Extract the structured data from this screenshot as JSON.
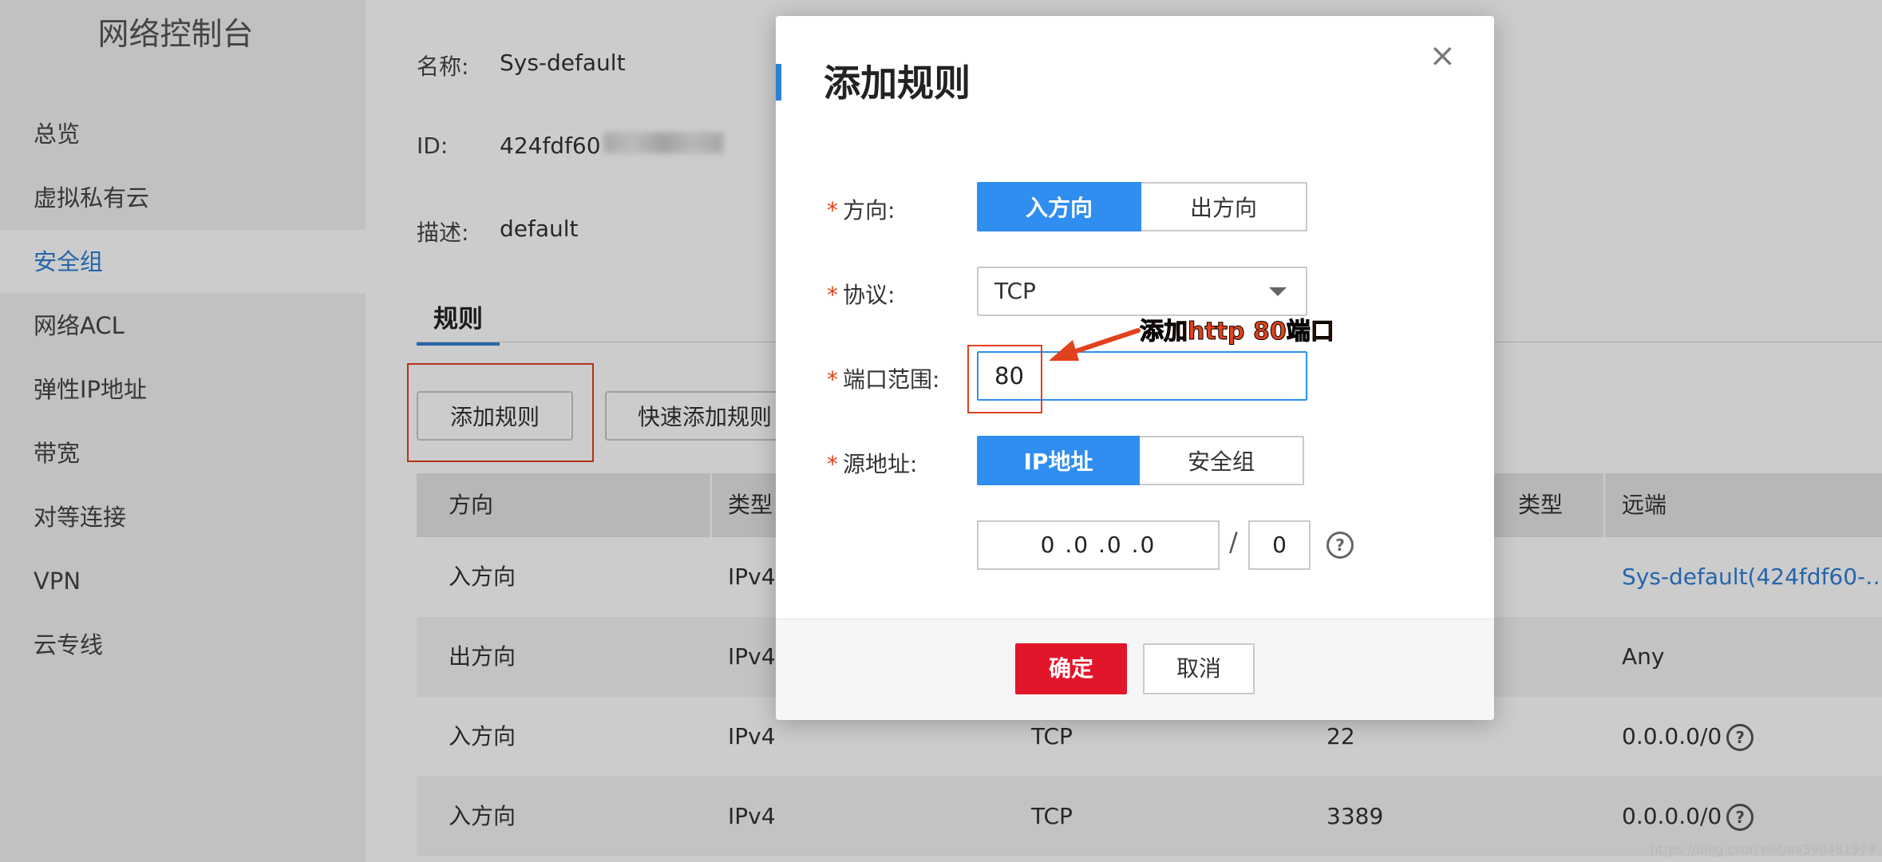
{
  "sidebar": {
    "title": "网络控制台",
    "items": [
      {
        "label": "总览"
      },
      {
        "label": "虚拟私有云"
      },
      {
        "label": "安全组"
      },
      {
        "label": "网络ACL"
      },
      {
        "label": "弹性IP地址"
      },
      {
        "label": "带宽"
      },
      {
        "label": "对等连接"
      },
      {
        "label": "VPN"
      },
      {
        "label": "云专线"
      }
    ],
    "active_index": 2
  },
  "info": {
    "name_label": "名称:",
    "name_value": "Sys-default",
    "id_label": "ID:",
    "id_value": "424fdf60",
    "desc_label": "描述:",
    "desc_value": "default"
  },
  "tab": {
    "label": "规则"
  },
  "buttons": {
    "add_rule": "添加规则",
    "quick_add_rule": "快速添加规则"
  },
  "table": {
    "headers": [
      "方向",
      "类型",
      "",
      "类型",
      "远端"
    ],
    "rows": [
      {
        "direction": "入方向",
        "type": "IPv4",
        "protocol": "",
        "port": "",
        "remote": "Sys-default(424fdf60-…",
        "remote_is_link": true
      },
      {
        "direction": "出方向",
        "type": "IPv4",
        "protocol": "",
        "port": "",
        "remote": "Any",
        "remote_is_link": false
      },
      {
        "direction": "入方向",
        "type": "IPv4",
        "protocol": "TCP",
        "port": "22",
        "remote": "0.0.0.0/0",
        "remote_is_link": false
      },
      {
        "direction": "入方向",
        "type": "IPv4",
        "protocol": "TCP",
        "port": "3389",
        "remote": "0.0.0.0/0",
        "remote_is_link": false
      }
    ]
  },
  "modal": {
    "title": "添加规则",
    "close_glyph": "×",
    "direction_label": "方向:",
    "direction_options": [
      "入方向",
      "出方向"
    ],
    "protocol_label": "协议:",
    "protocol_value": "TCP",
    "port_label": "端口范围:",
    "port_value": "80",
    "source_label": "源地址:",
    "source_options": [
      "IP地址",
      "安全组"
    ],
    "ip_value": "0 .0 .0 .0",
    "slash": "/",
    "mask_value": "0",
    "help_glyph": "?",
    "confirm": "确定",
    "cancel": "取消"
  },
  "annotation": {
    "text": "添加http 80端口"
  },
  "watermark": "https://blog.csdn.net/aa390481979",
  "colors": {
    "accent": "#2f8ef0",
    "danger": "#e2162b",
    "annotation": "#e0421c",
    "link": "#2f7fd6"
  }
}
